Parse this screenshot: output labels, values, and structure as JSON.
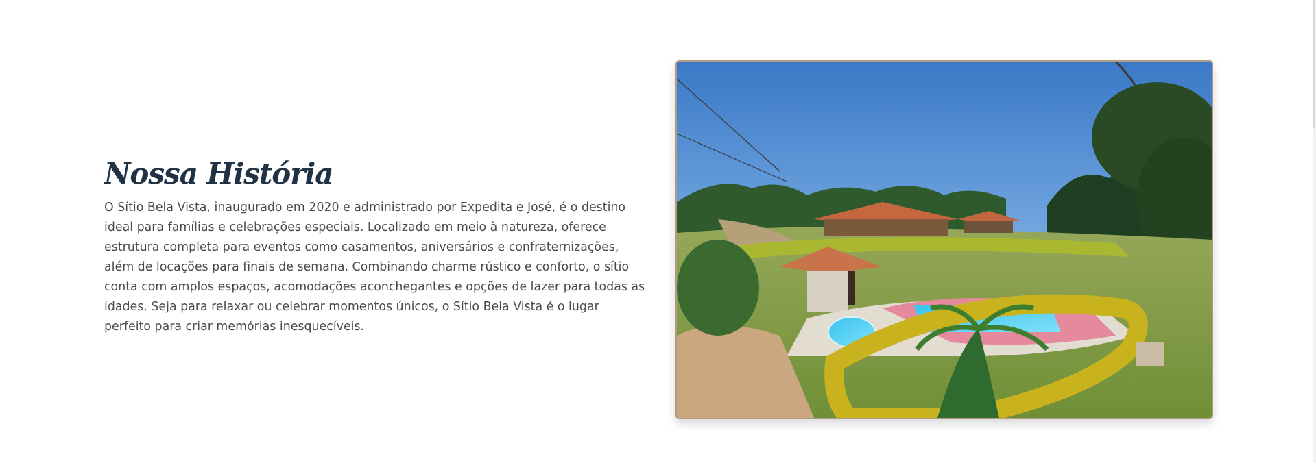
{
  "section": {
    "title": "Nossa História",
    "paragraph": "O Sítio Bela Vista, inaugurado em 2020 e administrado por Expedita e José, é o destino ideal para famílias e celebrações especiais. Localizado em meio à natureza, oferece estrutura completa para eventos como casamentos, aniversários e confraternizações, além de locações para finais de semana. Combinando charme rústico e conforto, o sítio conta com amplos espaços, acomodações aconchegantes e opções de lazer para todas as idades. Seja para relaxar ou celebrar momentos únicos, o Sítio Bela Vista é o lugar perfeito para criar memórias inesquecíveis."
  },
  "photo": {
    "frame_color": "#b29b83"
  },
  "colors": {
    "title": "#213244",
    "body_text": "#4b4b4b",
    "background": "#ffffff"
  }
}
